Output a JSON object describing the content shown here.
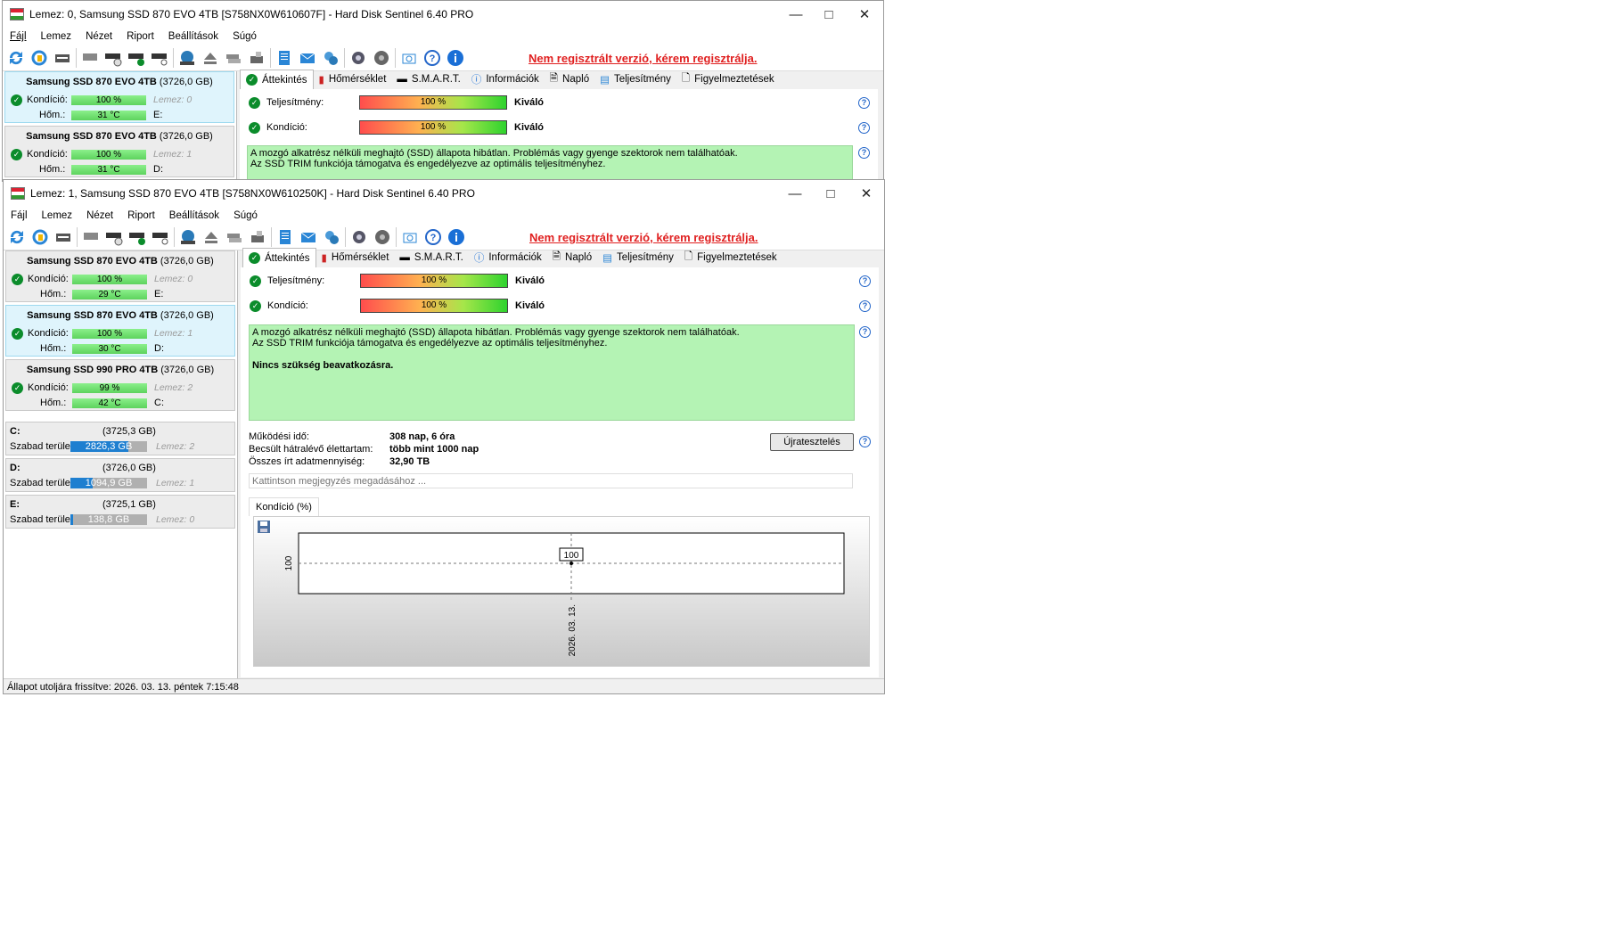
{
  "window1": {
    "title": "Lemez: 0, Samsung SSD 870 EVO 4TB [S758NX0W610607F]  -  Hard Disk Sentinel 6.40 PRO",
    "menu": [
      "Fájl",
      "Lemez",
      "Nézet",
      "Riport",
      "Beállítások",
      "Súgó"
    ],
    "register_notice": "Nem regisztrált verzió, kérem regisztrálja.",
    "disks": [
      {
        "name": "Samsung SSD 870 EVO 4TB",
        "size": "(3726,0 GB)",
        "health_label": "Kondíció:",
        "health": "100 %",
        "disk_no": "Lemez: 0",
        "temp_label": "Hőm.:",
        "temp": "31 °C",
        "drive": "E:"
      },
      {
        "name": "Samsung SSD 870 EVO 4TB",
        "size": "(3726,0 GB)",
        "health_label": "Kondíció:",
        "health": "100 %",
        "disk_no": "Lemez: 1",
        "temp_label": "Hőm.:",
        "temp": "31 °C",
        "drive": "D:"
      }
    ],
    "tabs": [
      "Áttekintés",
      "Hőmérséklet",
      "S.M.A.R.T.",
      "Információk",
      "Napló",
      "Teljesítmény",
      "Figyelmeztetések"
    ],
    "performance_label": "Teljesítmény:",
    "performance_value": "100 %",
    "performance_rating": "Kiváló",
    "condition_label": "Kondíció:",
    "condition_value": "100 %",
    "condition_rating": "Kiváló",
    "note_line1": "A mozgó alkatrész nélküli meghajtó (SSD) állapota hibátlan. Problémás vagy gyenge szektorok nem találhatóak.",
    "note_line2": "Az SSD TRIM funkciója támogatva és engedélyezve az optimális teljesítményhez."
  },
  "window2": {
    "title": "Lemez: 1, Samsung SSD 870 EVO 4TB [S758NX0W610250K]  -  Hard Disk Sentinel 6.40 PRO",
    "menu": [
      "Fájl",
      "Lemez",
      "Nézet",
      "Riport",
      "Beállítások",
      "Súgó"
    ],
    "register_notice": "Nem regisztrált verzió, kérem regisztrálja.",
    "disks": [
      {
        "name": "Samsung SSD 870 EVO 4TB",
        "size": "(3726,0 GB)",
        "health_label": "Kondíció:",
        "health": "100 %",
        "disk_no": "Lemez: 0",
        "temp_label": "Hőm.:",
        "temp": "29 °C",
        "drive": "E:"
      },
      {
        "name": "Samsung SSD 870 EVO 4TB",
        "size": "(3726,0 GB)",
        "health_label": "Kondíció:",
        "health": "100 %",
        "disk_no": "Lemez: 1",
        "temp_label": "Hőm.:",
        "temp": "30 °C",
        "drive": "D:"
      },
      {
        "name": "Samsung SSD 990 PRO 4TB",
        "size": "(3726,0 GB)",
        "health_label": "Kondíció:",
        "health": "99 %",
        "disk_no": "Lemez: 2",
        "temp_label": "Hőm.:",
        "temp": "42 °C",
        "drive": "C:"
      }
    ],
    "partitions": [
      {
        "letter": "C:",
        "size": "(3725,3 GB)",
        "free_label": "Szabad terület",
        "free": "2826,3 GB",
        "free_fraction": 0.76,
        "disk": "Lemez: 2"
      },
      {
        "letter": "D:",
        "size": "(3726,0 GB)",
        "free_label": "Szabad terület",
        "free": "1094,9 GB",
        "free_fraction": 0.29,
        "disk": "Lemez: 1"
      },
      {
        "letter": "E:",
        "size": "(3725,1 GB)",
        "free_label": "Szabad terület",
        "free": "138,8 GB",
        "free_fraction": 0.04,
        "disk": "Lemez: 0"
      }
    ],
    "tabs": [
      "Áttekintés",
      "Hőmérséklet",
      "S.M.A.R.T.",
      "Információk",
      "Napló",
      "Teljesítmény",
      "Figyelmeztetések"
    ],
    "performance_label": "Teljesítmény:",
    "performance_value": "100 %",
    "performance_rating": "Kiváló",
    "condition_label": "Kondíció:",
    "condition_value": "100 %",
    "condition_rating": "Kiváló",
    "note_line1": "A mozgó alkatrész nélküli meghajtó (SSD) állapota hibátlan. Problémás vagy gyenge szektorok nem találhatóak.",
    "note_line2": "Az SSD TRIM funkciója támogatva és engedélyezve az optimális teljesítményhez.",
    "note_bold": "Nincs szükség beavatkozásra.",
    "uptime_label": "Működési idő:",
    "uptime": "308 nap, 6 óra",
    "lifetime_label": "Becsült hátralévő élettartam:",
    "lifetime": "több mint 1000 nap",
    "written_label": "Összes írt adatmennyiség:",
    "written": "32,90 TB",
    "reset_button": "Újratesztelés",
    "comment_placeholder": "Kattintson megjegyzés megadásához ...",
    "chart_tab": "Kondíció  (%)",
    "status": "Állapot utoljára frissítve: 2026. 03. 13. péntek 7:15:48"
  },
  "chart_data": {
    "type": "line",
    "title": "Kondíció  (%)",
    "x": [
      "2026. 03. 13."
    ],
    "series": [
      {
        "values": [
          100
        ]
      }
    ],
    "ytick": "100",
    "point_label": "100",
    "ylim": [
      99,
      101
    ]
  },
  "colors": {
    "accent": "#1e7fd0",
    "register_red": "#e02020",
    "ok_green": "#0b8c2b",
    "note_green": "#b4f3b4"
  }
}
